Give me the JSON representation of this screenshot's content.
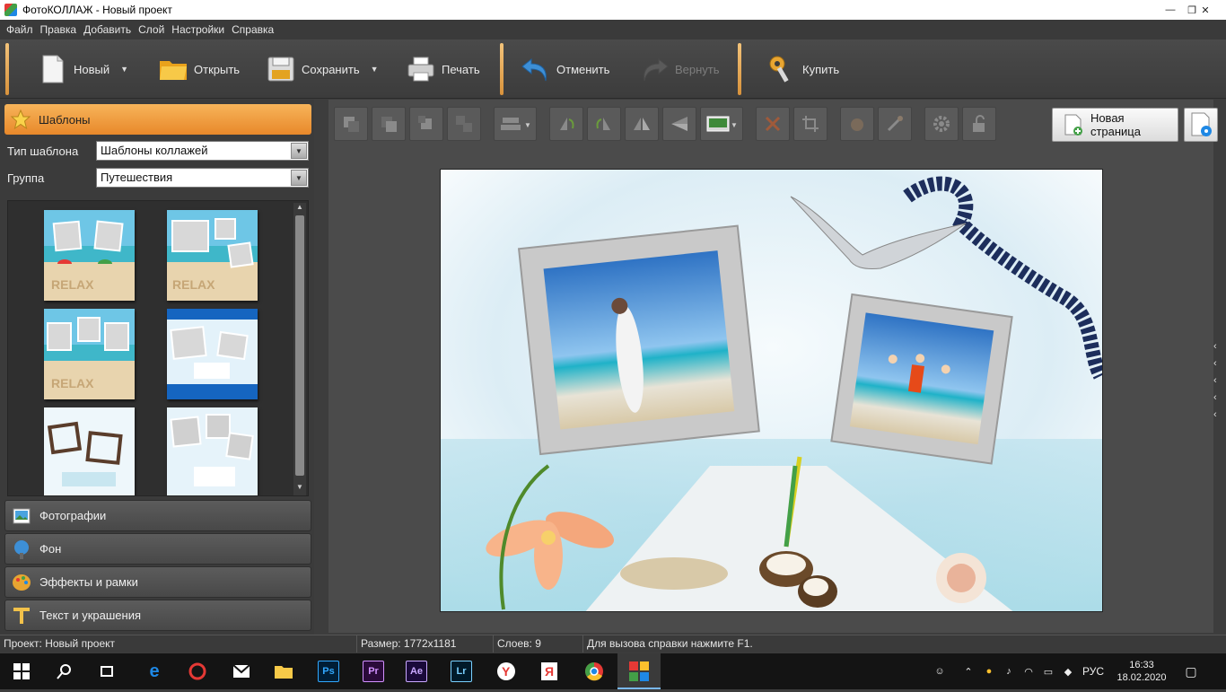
{
  "window": {
    "title": "ФотоКОЛЛАЖ - Новый проект",
    "controls": [
      "—",
      "❐",
      "✕"
    ]
  },
  "menu": [
    "Файл",
    "Правка",
    "Добавить",
    "Слой",
    "Настройки",
    "Справка"
  ],
  "toolbar": {
    "new_label": "Новый",
    "open_label": "Открыть",
    "save_label": "Сохранить",
    "print_label": "Печать",
    "undo_label": "Отменить",
    "redo_label": "Вернуть",
    "buy_label": "Купить"
  },
  "left": {
    "templates_label": "Шаблоны",
    "type_label": "Тип шаблона",
    "type_value": "Шаблоны коллажей",
    "group_label": "Группа",
    "group_value": "Путешествия",
    "photos_label": "Фотографии",
    "bg_label": "Фон",
    "effects_label": "Эффекты и рамки",
    "text_label": "Текст и украшения",
    "thumb_text": "RELAX"
  },
  "work": {
    "new_page_label": "Новая страница"
  },
  "status": {
    "project_label": "Проект:",
    "project_value": "Новый проект",
    "size_label": "Размер:",
    "size_value": "1772x1181",
    "layers_label": "Слоев:",
    "layers_value": "9",
    "help_text": "Для вызова справки нажмите F1."
  },
  "taskbar": {
    "apps": [
      "Ps",
      "Pr",
      "Ae",
      "Lr"
    ],
    "lang": "РУС",
    "time": "16:33",
    "date": "18.02.2020"
  },
  "colors": {
    "accent": "#e8882a",
    "panel": "#3b3b3b",
    "work": "#4b4b4b"
  }
}
